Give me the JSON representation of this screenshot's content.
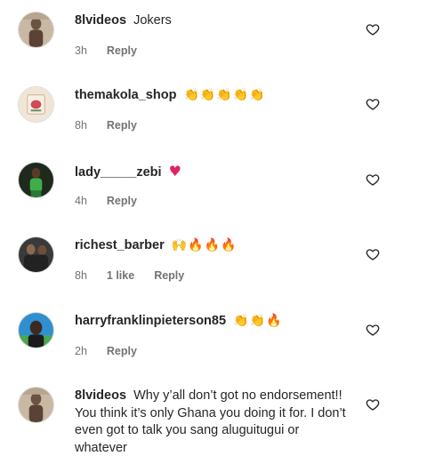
{
  "comments": [
    {
      "username": "8lvideos",
      "text": "Jokers",
      "emoji": "",
      "time": "3h",
      "likes": "",
      "reply_label": "Reply",
      "avatar_colors": [
        "#c9b8a3",
        "#6b5342"
      ]
    },
    {
      "username": "themakola_shop",
      "text": "",
      "emoji": "👏👏👏👏👏",
      "time": "8h",
      "likes": "",
      "reply_label": "Reply",
      "avatar_colors": [
        "#e8d9c4",
        "#d14a5a"
      ]
    },
    {
      "username": "lady_____zebi",
      "text": "",
      "emoji": "♥",
      "time": "4h",
      "likes": "",
      "reply_label": "Reply",
      "avatar_colors": [
        "#1e2a1c",
        "#3fae4a"
      ]
    },
    {
      "username": "richest_barber",
      "text": "",
      "emoji": "🙌🔥🔥🔥",
      "time": "8h",
      "likes": "1 like",
      "reply_label": "Reply",
      "avatar_colors": [
        "#3a3a3a",
        "#8a6a4e"
      ]
    },
    {
      "username": "harryfranklinpieterson85",
      "text": "",
      "emoji": "👏👏🔥",
      "time": "2h",
      "likes": "",
      "reply_label": "Reply",
      "avatar_colors": [
        "#2f8fcf",
        "#3b2a22"
      ]
    },
    {
      "username": "8lvideos",
      "text": "Why y’all don’t got no endorsement!! You think it’s only Ghana you doing it for. I don’t even got to talk you sang aluguitugui or whatever",
      "emoji": "",
      "time": "",
      "likes": "",
      "reply_label": "",
      "avatar_colors": [
        "#c9b8a3",
        "#6b5342"
      ]
    }
  ],
  "icons": {
    "like": "heart-outline-icon"
  }
}
